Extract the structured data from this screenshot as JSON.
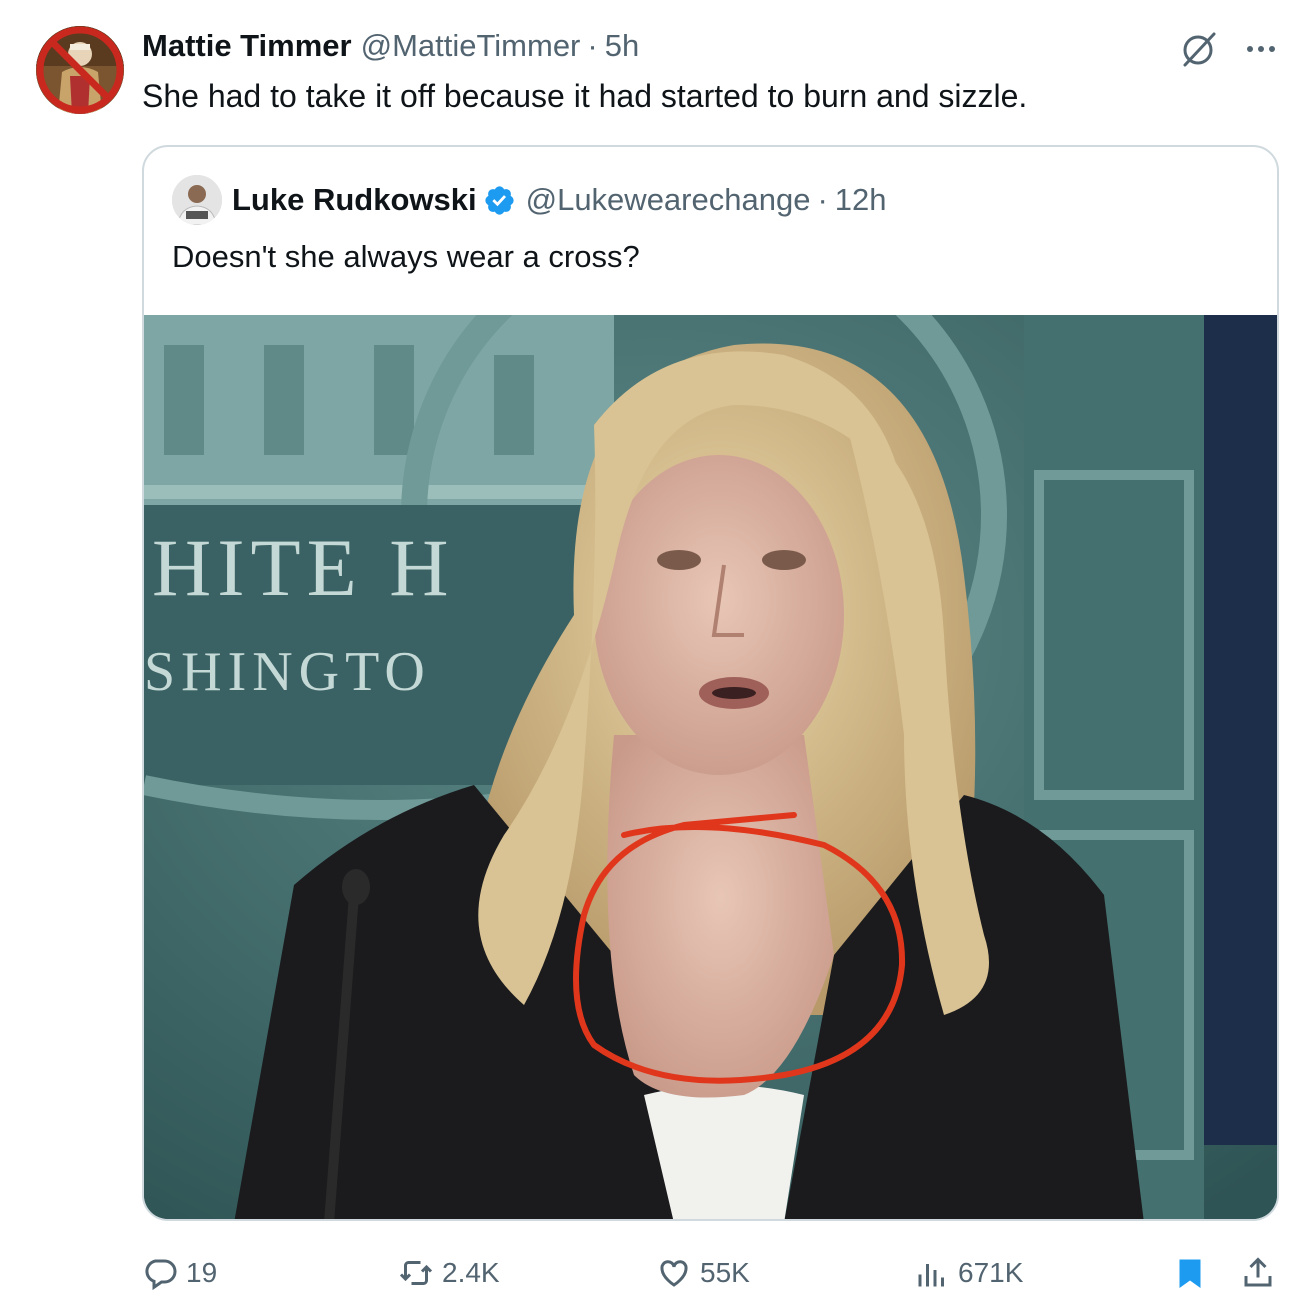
{
  "author": {
    "name": "Mattie Timmer",
    "handle": "@MattieTimmer",
    "separator": "·",
    "time": "5h"
  },
  "tweet_text": "She had to take it off because it had started to burn and sizzle.",
  "quoted": {
    "name": "Luke Rudkowski",
    "handle": "@Lukewearechange",
    "separator": "·",
    "time": "12h",
    "text": "Doesn't she always wear a cross?",
    "media": {
      "backdrop_lettering_line1": "HITE H",
      "backdrop_lettering_line2": "SHINGTO",
      "annotation_color": "#e0371c"
    }
  },
  "actions": {
    "replies": "19",
    "reposts": "2.4K",
    "likes": "55K",
    "views": "671K"
  },
  "colors": {
    "text": "#0f1419",
    "secondary": "#536471",
    "border": "#cfd9de",
    "verified": "#1d9bf0",
    "bookmark": "#1d9bf0"
  },
  "icons": [
    "reply-icon",
    "repost-icon",
    "like-icon",
    "views-icon",
    "bookmark-icon",
    "share-icon",
    "grok-icon",
    "more-icon",
    "verified-badge-icon"
  ]
}
